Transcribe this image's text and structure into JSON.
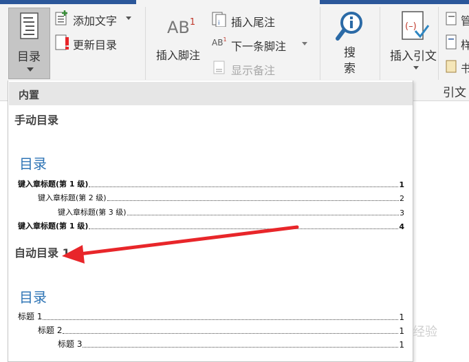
{
  "ribbon": {
    "toc_button": "目录",
    "add_text": "添加文字",
    "update_toc": "更新目录",
    "insert_footnote": "插入脚注",
    "insert_endnote": "插入尾注",
    "next_footnote": "下一条脚注",
    "show_notes": "显示备注",
    "search": "搜\n索",
    "insert_citation": "插入引文",
    "manage_partial": "管",
    "style_partial": "样",
    "bibliography_partial": "书",
    "citation_group_partial": "引文",
    "footnote_icon_text": "AB",
    "footnote_superscript": "1",
    "next_footnote_icon_text": "AB",
    "next_footnote_superscript": "1"
  },
  "dropdown": {
    "section_label": "内置",
    "manual": {
      "heading": "手动目录",
      "title": "目录",
      "entries": [
        {
          "text": "键入章标题(第 1 级)",
          "page": "1",
          "level": 1
        },
        {
          "text": "键入章标题(第 2 级)",
          "page": "2",
          "level": 2
        },
        {
          "text": "键入章标题(第 3 级)",
          "page": "3",
          "level": 3
        },
        {
          "text": "键入章标题(第 1 级)",
          "page": "4",
          "level": 1
        }
      ]
    },
    "auto": {
      "heading": "自动目录 1",
      "title": "目录",
      "entries": [
        {
          "text": "标题 1",
          "page": "1",
          "level": 1
        },
        {
          "text": "标题 2",
          "page": "1",
          "level": 2
        },
        {
          "text": "标题 3",
          "page": "1",
          "level": 3
        }
      ]
    }
  },
  "watermark": "经验",
  "colors": {
    "accent": "#2b579a",
    "toc_title": "#2e74b5",
    "annotation_arrow": "#e8262a"
  }
}
